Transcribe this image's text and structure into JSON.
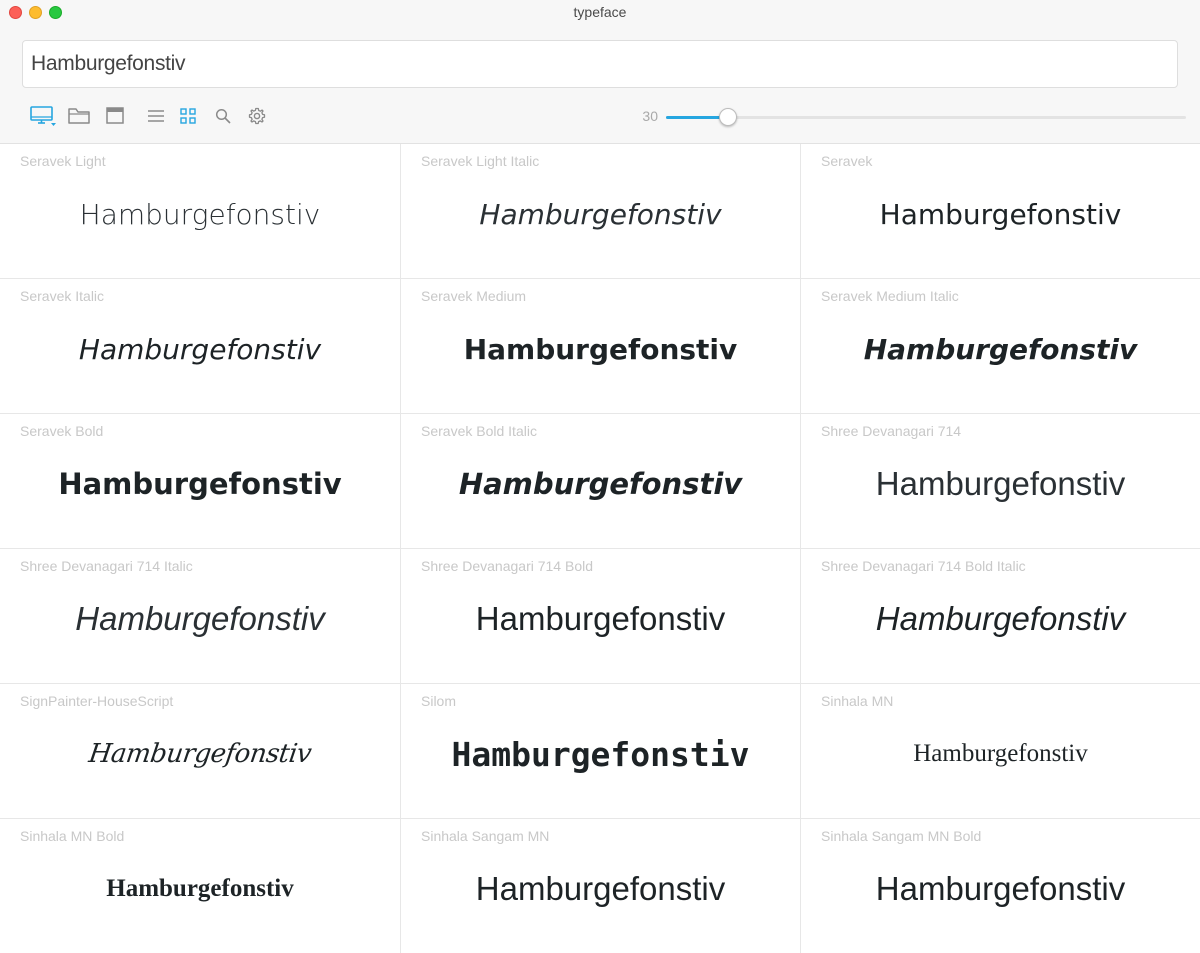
{
  "window": {
    "title": "typeface"
  },
  "preview": {
    "value": "Hamburgefonstiv"
  },
  "toolbar": {
    "active_color": "#26a6e0",
    "icons": [
      "monitor-icon",
      "folder-icon",
      "window-icon",
      "list-view-icon",
      "grid-view-icon",
      "search-icon",
      "gear-icon"
    ]
  },
  "size": {
    "value": "30",
    "slider_fraction": 0.12
  },
  "fonts": [
    {
      "name": "Seravek Light",
      "sample": "Hamburgefonstiv",
      "style": "s-light"
    },
    {
      "name": "Seravek Light Italic",
      "sample": "Hamburgefonstiv",
      "style": "s-light-italic"
    },
    {
      "name": "Seravek",
      "sample": "Hamburgefonstiv",
      "style": "s-regular"
    },
    {
      "name": "Seravek Italic",
      "sample": "Hamburgefonstiv",
      "style": "s-italic"
    },
    {
      "name": "Seravek Medium",
      "sample": "Hamburgefonstiv",
      "style": "s-medium"
    },
    {
      "name": "Seravek Medium Italic",
      "sample": "Hamburgefonstiv",
      "style": "s-medium-italic"
    },
    {
      "name": "Seravek Bold",
      "sample": "Hamburgefonstiv",
      "style": "s-bold"
    },
    {
      "name": "Seravek Bold Italic",
      "sample": "Hamburgefonstiv",
      "style": "s-bold-italic"
    },
    {
      "name": "Shree Devanagari 714",
      "sample": "Hamburgefonstiv",
      "style": "s-shree"
    },
    {
      "name": "Shree Devanagari 714 Italic",
      "sample": "Hamburgefonstiv",
      "style": "s-shree-italic"
    },
    {
      "name": "Shree Devanagari 714 Bold",
      "sample": "Hamburgefonstiv",
      "style": "s-shree-bold"
    },
    {
      "name": "Shree Devanagari 714 Bold Italic",
      "sample": "Hamburgefonstiv",
      "style": "s-shree-bold-italic"
    },
    {
      "name": "SignPainter-HouseScript",
      "sample": "Hamburgefonstiv",
      "style": "s-script"
    },
    {
      "name": "Silom",
      "sample": "Hamburgefonstiv",
      "style": "s-silom"
    },
    {
      "name": "Sinhala MN",
      "sample": "Hamburgefonstiv",
      "style": "s-sinhala"
    },
    {
      "name": "Sinhala MN Bold",
      "sample": "Hamburgefonstiv",
      "style": "s-sinhala-bold"
    },
    {
      "name": "Sinhala Sangam MN",
      "sample": "Hamburgefonstiv",
      "style": "s-sangam"
    },
    {
      "name": "Sinhala Sangam MN Bold",
      "sample": "Hamburgefonstiv",
      "style": "s-sangam-bold"
    }
  ]
}
